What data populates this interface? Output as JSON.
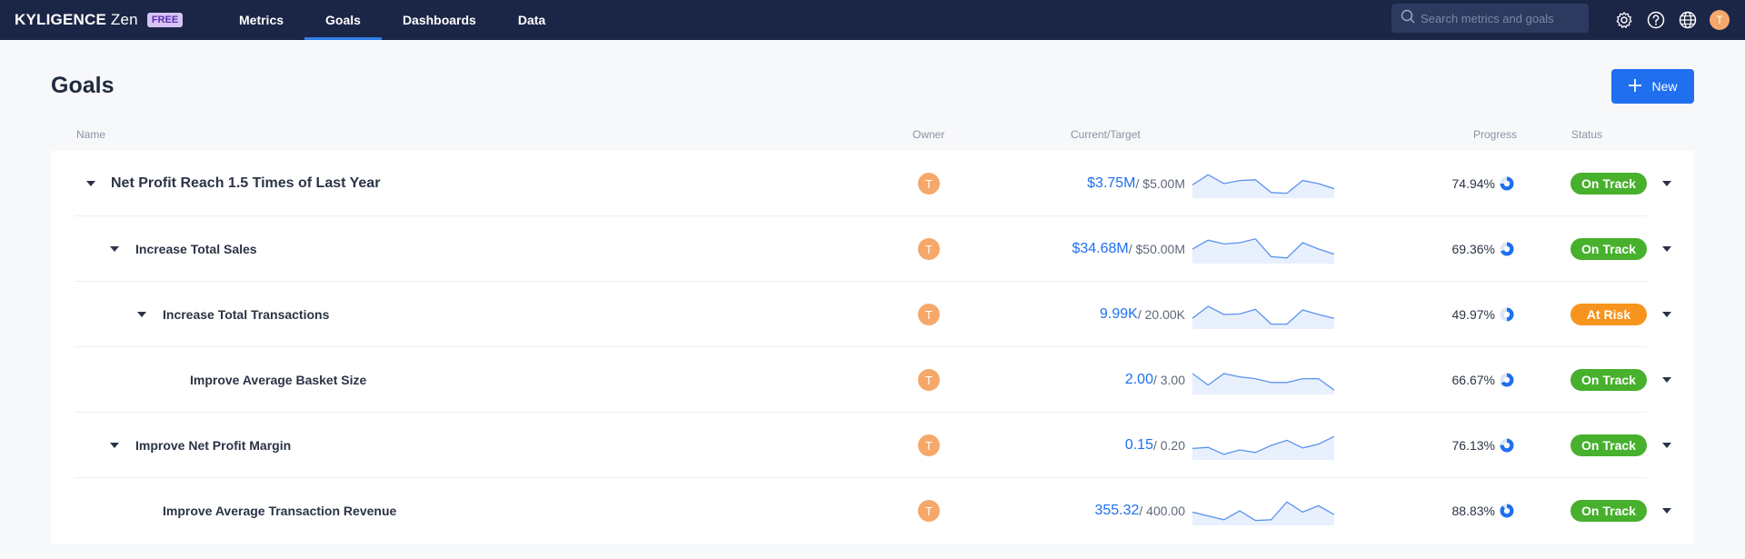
{
  "brand": {
    "name_bold": "KYLIGENCE",
    "name_light": "Zen",
    "badge": "FREE"
  },
  "nav": [
    {
      "label": "Metrics",
      "active": false
    },
    {
      "label": "Goals",
      "active": true
    },
    {
      "label": "Dashboards",
      "active": false
    },
    {
      "label": "Data",
      "active": false
    }
  ],
  "search": {
    "placeholder": "Search metrics and goals"
  },
  "top_icons": [
    "gear-icon",
    "help-icon",
    "globe-icon"
  ],
  "user": {
    "initial": "T"
  },
  "page": {
    "title": "Goals",
    "new_label": "New"
  },
  "table": {
    "headers": {
      "name": "Name",
      "owner": "Owner",
      "current_target": "Current/Target",
      "progress": "Progress",
      "status": "Status"
    },
    "rows": [
      {
        "name": "Net Profit Reach 1.5 Times of Last Year",
        "level": 0,
        "expandable": true,
        "owner": "T",
        "current": "$3.75M",
        "target": "/ $5.00M",
        "trend": [
          0.45,
          0.85,
          0.5,
          0.62,
          0.65,
          0.15,
          0.12,
          0.62,
          0.5,
          0.3
        ],
        "progress_text": "74.94%",
        "progress": 0.7494,
        "status": "On Track",
        "status_color": "#47b02d"
      },
      {
        "name": "Increase Total Sales",
        "level": 1,
        "expandable": true,
        "owner": "T",
        "current": "$34.68M",
        "target": "/ $50.00M",
        "trend": [
          0.5,
          0.85,
          0.7,
          0.75,
          0.9,
          0.2,
          0.15,
          0.75,
          0.5,
          0.3
        ],
        "progress_text": "69.36%",
        "progress": 0.6936,
        "status": "On Track",
        "status_color": "#47b02d"
      },
      {
        "name": "Increase Total Transactions",
        "level": 2,
        "expandable": true,
        "owner": "T",
        "current": "9.99K",
        "target": "/ 20.00K",
        "trend": [
          0.35,
          0.82,
          0.5,
          0.52,
          0.7,
          0.12,
          0.12,
          0.68,
          0.5,
          0.35
        ],
        "progress_text": "49.97%",
        "progress": 0.4997,
        "status": "At Risk",
        "status_color": "#f7941d"
      },
      {
        "name": "Improve Average Basket Size",
        "level": 3,
        "expandable": false,
        "owner": "T",
        "current": "2.00",
        "target": "/ 3.00",
        "trend": [
          0.75,
          0.3,
          0.75,
          0.62,
          0.55,
          0.4,
          0.4,
          0.55,
          0.55,
          0.1
        ],
        "progress_text": "66.67%",
        "progress": 0.6667,
        "status": "On Track",
        "status_color": "#47b02d"
      },
      {
        "name": "Improve Net Profit Margin",
        "level": 1,
        "expandable": true,
        "owner": "T",
        "current": "0.15",
        "target": "/ 0.20",
        "trend": [
          0.38,
          0.42,
          0.15,
          0.32,
          0.22,
          0.5,
          0.7,
          0.4,
          0.55,
          0.85
        ],
        "progress_text": "76.13%",
        "progress": 0.7613,
        "status": "On Track",
        "status_color": "#47b02d"
      },
      {
        "name": "Improve Average Transaction Revenue",
        "level": 2,
        "expandable": false,
        "owner": "T",
        "current": "355.32",
        "target": "/ 400.00",
        "trend": [
          0.45,
          0.3,
          0.15,
          0.5,
          0.12,
          0.15,
          0.85,
          0.45,
          0.7,
          0.35
        ],
        "progress_text": "88.83%",
        "progress": 0.8883,
        "status": "On Track",
        "status_color": "#47b02d"
      }
    ]
  },
  "colors": {
    "topbar": "#1b2646",
    "accent": "#1f6fef",
    "on_track": "#47b02d",
    "at_risk": "#f7941d",
    "avatar": "#f5a86a"
  }
}
